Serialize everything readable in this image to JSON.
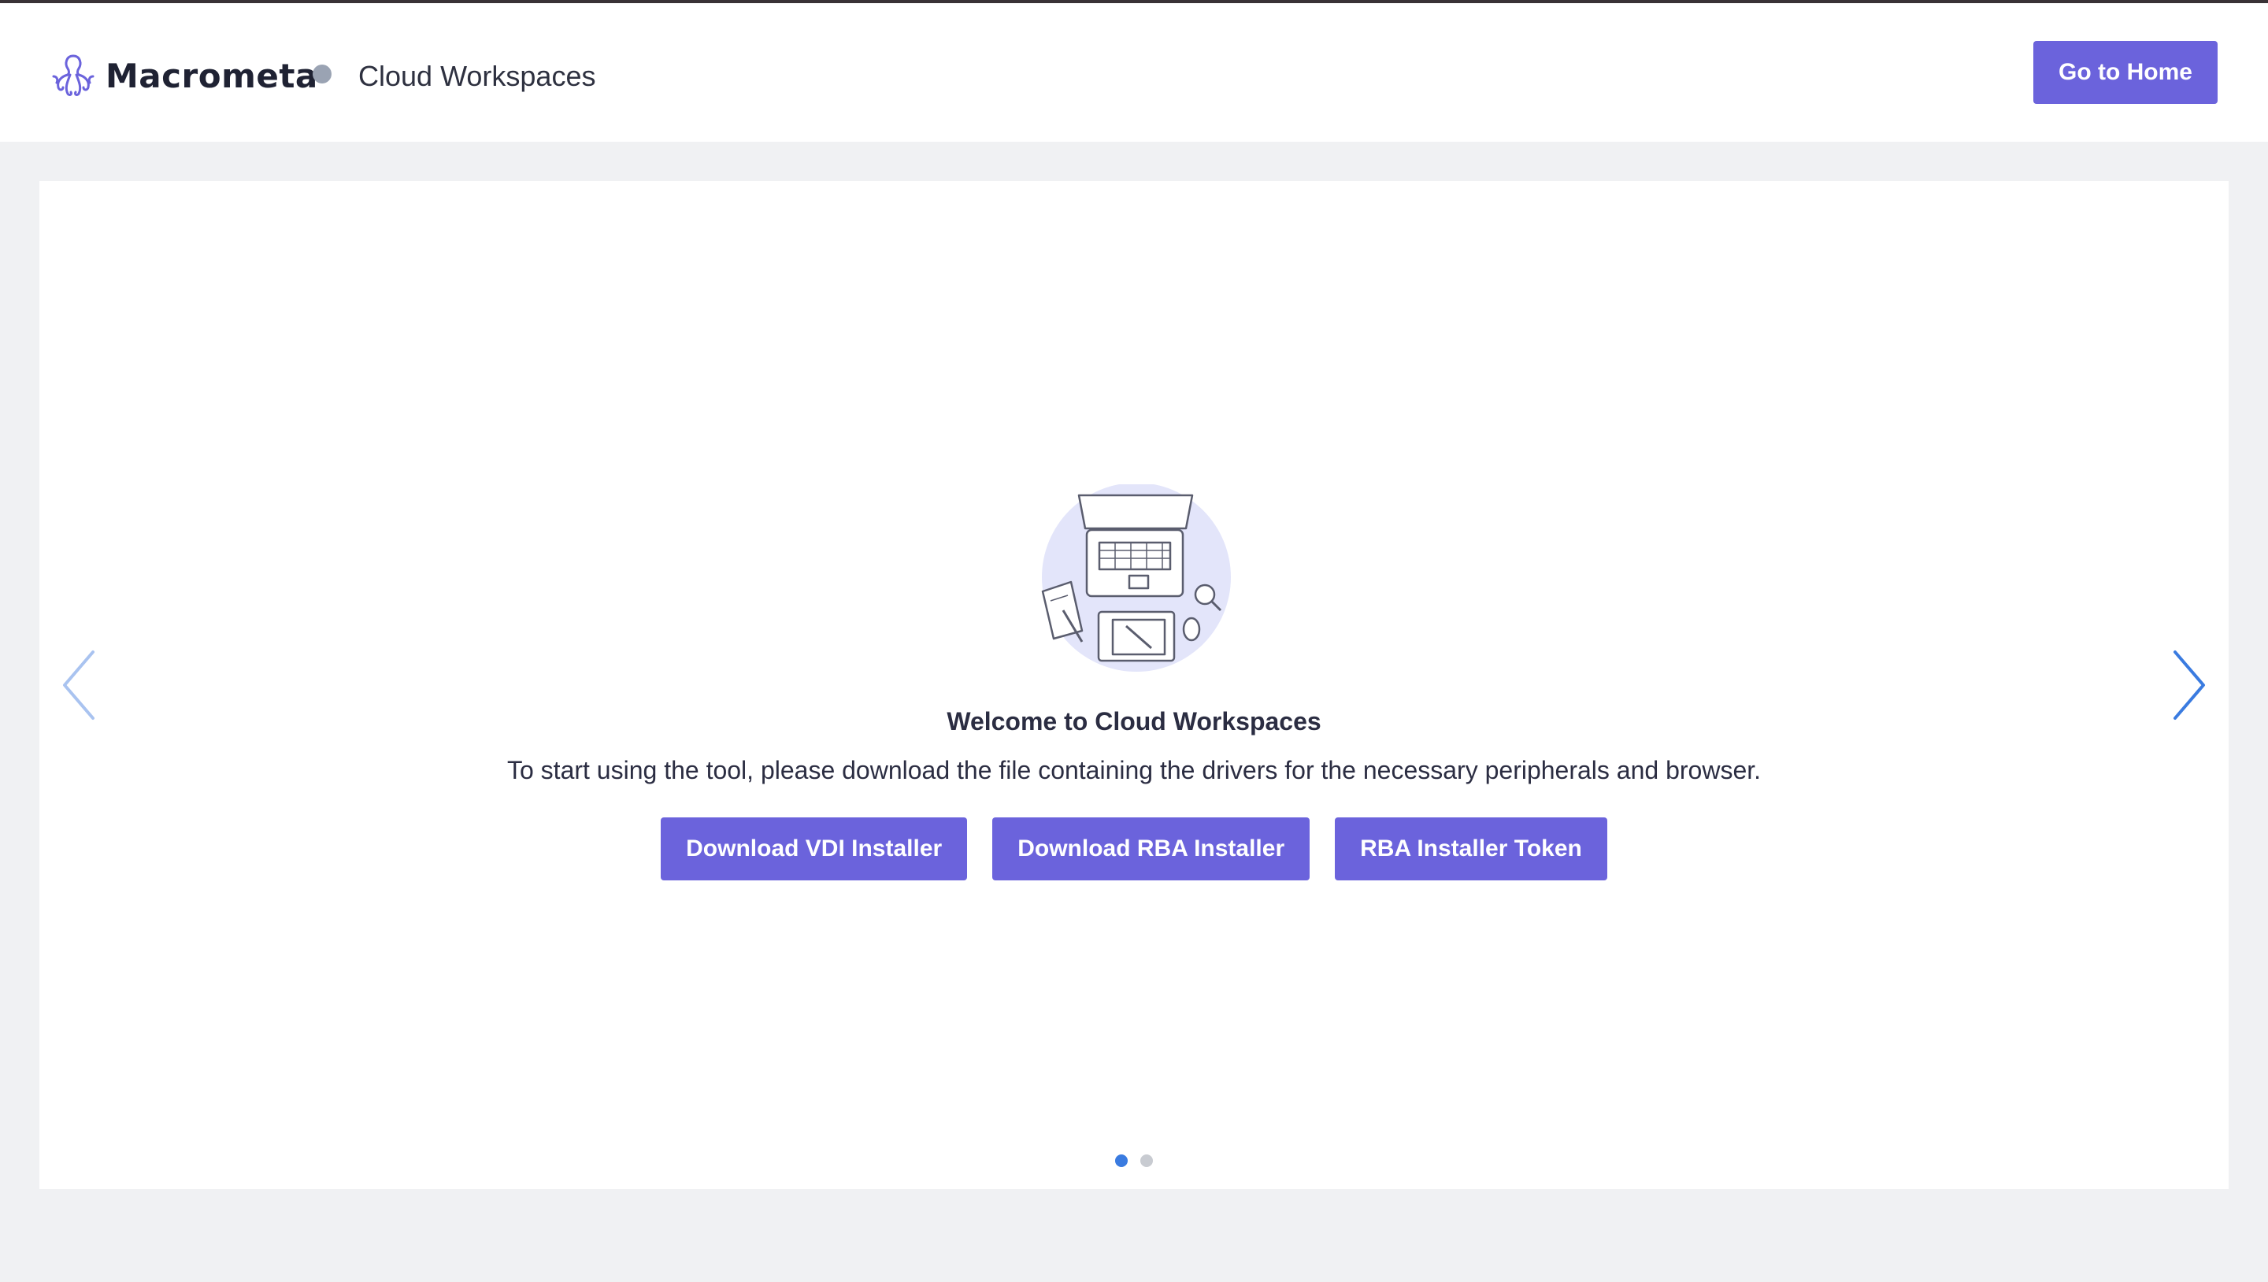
{
  "header": {
    "brand_name": "Macrometa",
    "product_name": "Cloud Workspaces",
    "go_home_label": "Go to Home"
  },
  "carousel": {
    "title": "Welcome to Cloud Workspaces",
    "description": "To start using the tool, please download the file containing the drivers for the necessary peripherals and browser.",
    "buttons": [
      {
        "label": "Download VDI Installer"
      },
      {
        "label": "Download RBA Installer"
      },
      {
        "label": "RBA Installer Token"
      }
    ],
    "slide_count": 2,
    "active_slide": 1
  },
  "icons": {
    "brand_logo": "octopus-logo-icon",
    "prev": "chevron-left-icon",
    "next": "chevron-right-icon",
    "illustration": "workspace-illustration-icon"
  },
  "colors": {
    "accent": "#6b63dc",
    "dot_active": "#3a7be0",
    "dot_inactive": "#c8cbd1",
    "arrow_active": "#3a7be0",
    "arrow_inactive": "#a9c3f0",
    "status_dot": "#9aa3b3"
  }
}
